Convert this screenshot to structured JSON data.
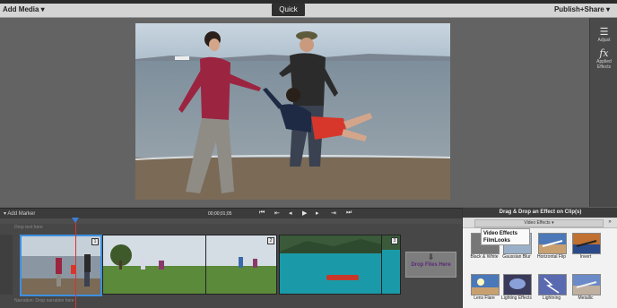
{
  "toolbar": {
    "add_media": "Add Media ▾",
    "quick": "Quick",
    "publish_share": "Publish+Share ▾"
  },
  "right_panel": {
    "adjust": "Adjust",
    "applied_effects": "Applied Effects"
  },
  "transport": {
    "add_marker": "Add Marker",
    "timecode": "00;00;01;05"
  },
  "timeline": {
    "hint_top": "Drop text here",
    "hint_bottom": "Narration: Drop narration here",
    "drop_files": "Drop Files Here",
    "clip_numbers": [
      "1",
      "2",
      "3"
    ]
  },
  "effects": {
    "title": "Drag & Drop an Effect on Clip(s)",
    "category": "Video Effects ▾",
    "popup": [
      "Video Effects",
      "FilmLooks"
    ],
    "tiles_row1": [
      "Black & White",
      "Gaussian Blur",
      "Horizontal Flip",
      "Invert"
    ],
    "tiles_row2": [
      "Lens Flare",
      "Lighting Effects",
      "Lightning",
      "Metallic"
    ]
  }
}
